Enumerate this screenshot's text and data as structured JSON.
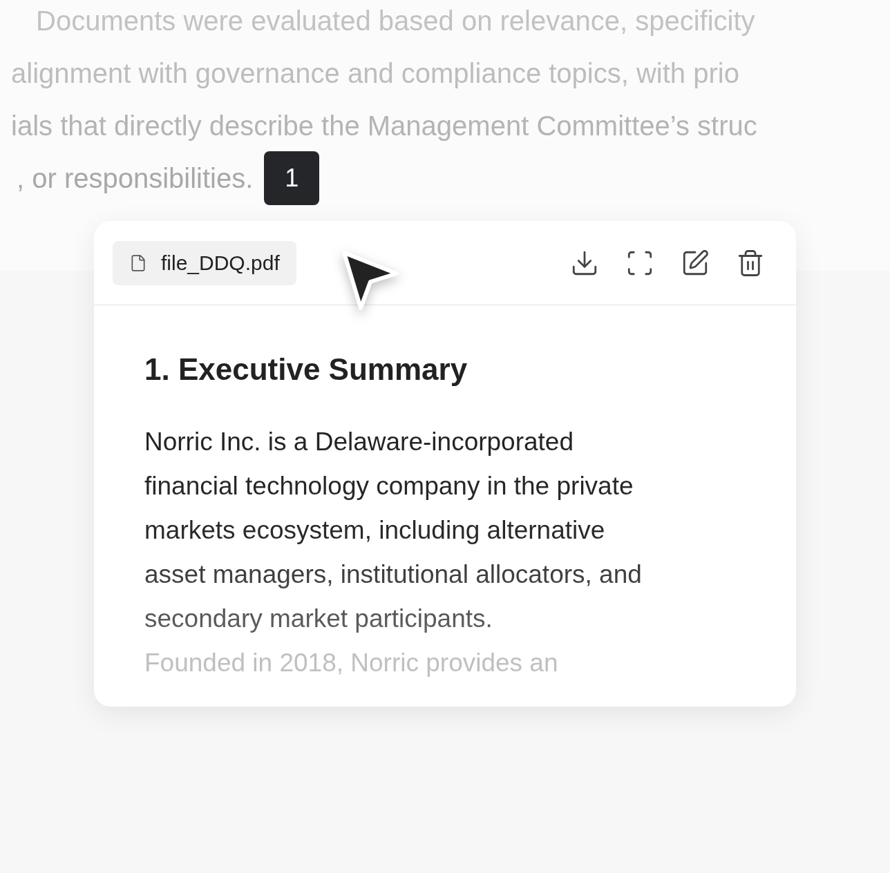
{
  "background_text": [
    "Documents were evaluated based on relevance, specificity",
    "alignment with governance and compliance topics, with prio",
    "ials that directly describe the Management Committee’s struc",
    ", or responsibilities."
  ],
  "citation_badge": "1",
  "document_card": {
    "file_name": "file_DDQ.pdf",
    "heading": "1. Executive Summary",
    "paragraphs": [
      "Norric Inc. is a Delaware-incorporated financial technology company in the private markets ecosystem, including alternative asset managers, institutional allocators, and secondary market participants.",
      "Founded in 2018, Norric provides an"
    ]
  }
}
